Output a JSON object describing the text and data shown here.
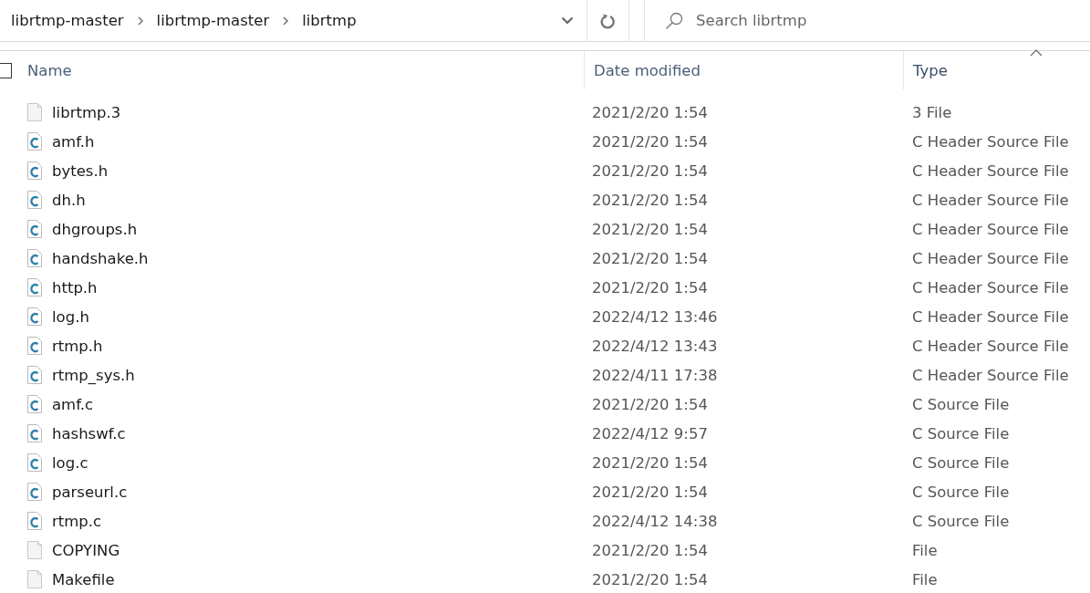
{
  "address_bar": {
    "breadcrumbs": [
      "librtmp-master",
      "librtmp-master",
      "librtmp"
    ]
  },
  "search": {
    "placeholder": "Search librtmp"
  },
  "select_all": {
    "checked": false
  },
  "columns": [
    {
      "label": "Name",
      "sorted": false
    },
    {
      "label": "Date modified",
      "sorted": false
    },
    {
      "label": "Type",
      "sorted": true
    }
  ],
  "files": [
    {
      "name": "librtmp.3",
      "date": "2021/2/20 1:54",
      "type": "3 File",
      "kind": "file"
    },
    {
      "name": "amf.h",
      "date": "2021/2/20 1:54",
      "type": "C Header Source File",
      "kind": "c"
    },
    {
      "name": "bytes.h",
      "date": "2021/2/20 1:54",
      "type": "C Header Source File",
      "kind": "c"
    },
    {
      "name": "dh.h",
      "date": "2021/2/20 1:54",
      "type": "C Header Source File",
      "kind": "c"
    },
    {
      "name": "dhgroups.h",
      "date": "2021/2/20 1:54",
      "type": "C Header Source File",
      "kind": "c"
    },
    {
      "name": "handshake.h",
      "date": "2021/2/20 1:54",
      "type": "C Header Source File",
      "kind": "c"
    },
    {
      "name": "http.h",
      "date": "2021/2/20 1:54",
      "type": "C Header Source File",
      "kind": "c"
    },
    {
      "name": "log.h",
      "date": "2022/4/12 13:46",
      "type": "C Header Source File",
      "kind": "c"
    },
    {
      "name": "rtmp.h",
      "date": "2022/4/12 13:43",
      "type": "C Header Source File",
      "kind": "c"
    },
    {
      "name": "rtmp_sys.h",
      "date": "2022/4/11 17:38",
      "type": "C Header Source File",
      "kind": "c"
    },
    {
      "name": "amf.c",
      "date": "2021/2/20 1:54",
      "type": "C Source File",
      "kind": "c"
    },
    {
      "name": "hashswf.c",
      "date": "2022/4/12 9:57",
      "type": "C Source File",
      "kind": "c"
    },
    {
      "name": "log.c",
      "date": "2021/2/20 1:54",
      "type": "C Source File",
      "kind": "c"
    },
    {
      "name": "parseurl.c",
      "date": "2021/2/20 1:54",
      "type": "C Source File",
      "kind": "c"
    },
    {
      "name": "rtmp.c",
      "date": "2022/4/12 14:38",
      "type": "C Source File",
      "kind": "c"
    },
    {
      "name": "COPYING",
      "date": "2021/2/20 1:54",
      "type": "File",
      "kind": "file"
    },
    {
      "name": "Makefile",
      "date": "2021/2/20 1:54",
      "type": "File",
      "kind": "file"
    }
  ]
}
